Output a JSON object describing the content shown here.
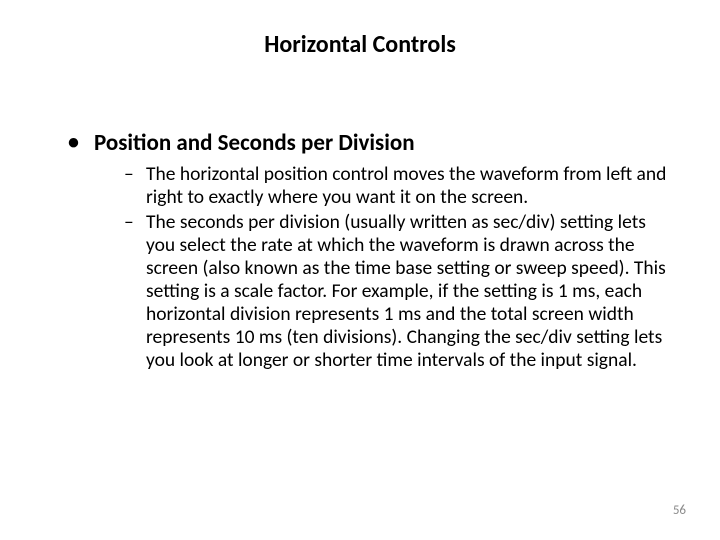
{
  "title": "Horizontal Controls",
  "bullet1": {
    "heading": "Position and Seconds per Division",
    "sub1": "The horizontal position control moves the waveform from left and right to exactly where you want it on the screen.",
    "sub2": "The seconds per division (usually written as sec/div) setting lets you select the rate at which the waveform is drawn across the screen (also known as the time base setting or sweep speed). This setting is a scale factor. For example, if the setting is 1 ms, each horizontal division represents 1 ms and the total screen width represents 10 ms (ten divisions). Changing the sec/div setting lets you look at longer or shorter time intervals of the input signal."
  },
  "page_number": "56"
}
